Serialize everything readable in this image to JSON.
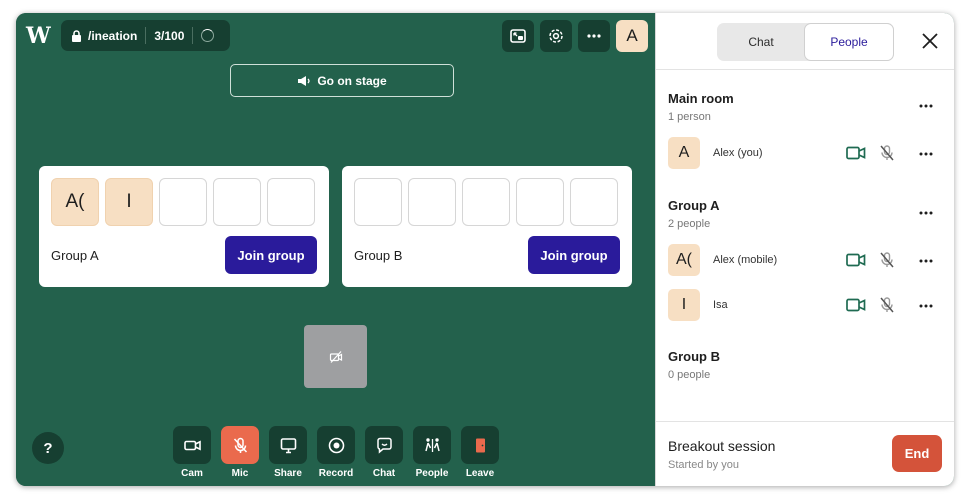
{
  "stage": {
    "logo": "W",
    "room_name": "/ineation",
    "capacity": "3/100",
    "user_avatar": "A",
    "go_on_stage": "Go on stage",
    "help": "?",
    "groups": [
      {
        "name": "Group A",
        "join_label": "Join group",
        "slots": [
          "A(",
          "I",
          "",
          "",
          ""
        ]
      },
      {
        "name": "Group B",
        "join_label": "Join group",
        "slots": [
          "",
          "",
          "",
          "",
          ""
        ]
      }
    ],
    "toolbar": [
      {
        "label": "Cam",
        "icon": "camera-icon"
      },
      {
        "label": "Mic",
        "icon": "mic-off-icon"
      },
      {
        "label": "Share",
        "icon": "screen-share-icon"
      },
      {
        "label": "Record",
        "icon": "record-icon"
      },
      {
        "label": "Chat",
        "icon": "chat-icon"
      },
      {
        "label": "People",
        "icon": "people-icon"
      },
      {
        "label": "Leave",
        "icon": "leave-icon"
      }
    ]
  },
  "panel": {
    "tabs": {
      "chat": "Chat",
      "people": "People",
      "active": "People"
    },
    "rooms": [
      {
        "title": "Main room",
        "count": "1 person",
        "people": [
          {
            "avatar": "A",
            "name": "Alex (you)"
          }
        ]
      },
      {
        "title": "Group A",
        "count": "2 people",
        "people": [
          {
            "avatar": "A(",
            "name": "Alex (mobile)"
          },
          {
            "avatar": "I",
            "name": "Isa"
          }
        ]
      },
      {
        "title": "Group B",
        "count": "0 people",
        "people": []
      }
    ],
    "footer": {
      "title": "Breakout session",
      "subtitle": "Started by you",
      "end_label": "End"
    }
  },
  "colors": {
    "stage_bg": "#23614c",
    "dark_button": "#163f31",
    "join_button": "#2a1b9b",
    "mic_off": "#ea6a4d",
    "end_button": "#d4533a",
    "avatar_bg": "#f7dfc3",
    "cam_on": "#1f6b52"
  }
}
